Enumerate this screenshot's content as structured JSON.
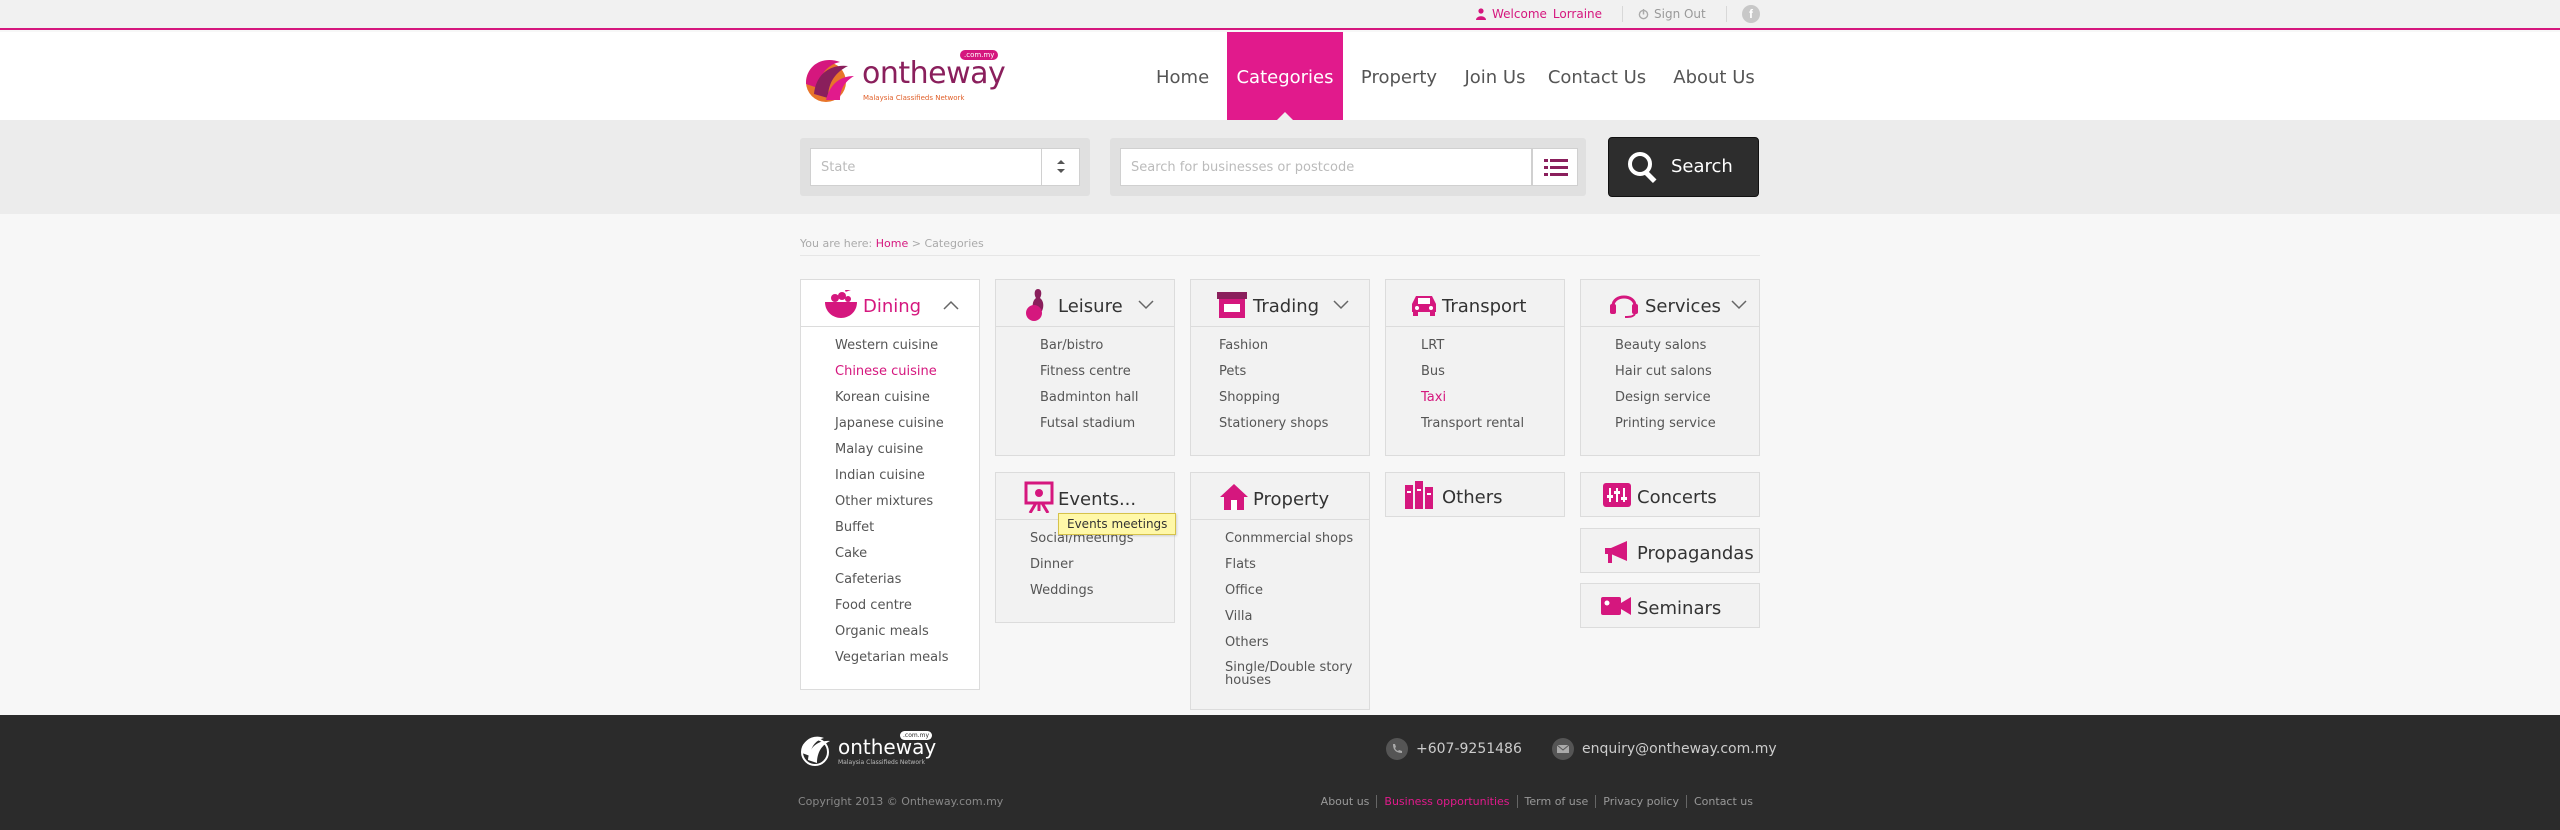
{
  "topbar": {
    "welcome_label": "Welcome",
    "user_name": "Lorraine",
    "signout_label": "Sign Out",
    "facebook_glyph": "f"
  },
  "header": {
    "logo_brand": "ontheway",
    "logo_tagline": "Malaysia Classifieds Network",
    "logo_domain": ".com.my",
    "nav": [
      {
        "label": "Home"
      },
      {
        "label": "Categories",
        "active": true
      },
      {
        "label": "Property"
      },
      {
        "label": "Join Us"
      },
      {
        "label": "Contact Us"
      },
      {
        "label": "About Us"
      }
    ]
  },
  "search": {
    "state_placeholder": "State",
    "query_placeholder": "Search for businesses or postcode",
    "button_label": "Search"
  },
  "breadcrumb": {
    "prefix": "You are here:",
    "home": "Home",
    "separator": ">",
    "current": "Categories"
  },
  "categories": {
    "dining": {
      "title": "Dining",
      "items": [
        "Western cuisine",
        "Chinese cuisine",
        "Korean cuisine",
        "Japanese cuisine",
        "Malay cuisine",
        "Indian cuisine",
        "Other mixtures",
        "Buffet",
        "Cake",
        "Cafeterias",
        "Food centre",
        "Organic meals",
        "Vegetarian meals"
      ]
    },
    "leisure": {
      "title": "Leisure",
      "items": [
        "Bar/bistro",
        "Fitness centre",
        "Badminton hall",
        "Futsal stadium"
      ]
    },
    "trading": {
      "title": "Trading",
      "items": [
        "Fashion",
        "Pets",
        "Shopping",
        "Stationery shops"
      ]
    },
    "transport": {
      "title": "Transport",
      "items": [
        "LRT",
        "Bus",
        "Taxi",
        "Transport  rental"
      ]
    },
    "services": {
      "title": "Services",
      "items": [
        "Beauty  salons",
        "Hair  cut  salons",
        "Design  service",
        "Printing  service"
      ]
    },
    "events": {
      "title": "Events...",
      "items": [
        "Social/meetings",
        "Dinner",
        "Weddings"
      ],
      "tooltip": "Events  meetings"
    },
    "property": {
      "title": "Property",
      "items": [
        "Conmmercial  shops",
        "Flats",
        "Office",
        "Villa",
        "Others",
        "Single/Double story houses"
      ]
    },
    "others": {
      "title": "Others"
    },
    "concerts": {
      "title": "Concerts"
    },
    "propagandas": {
      "title": "Propagandas"
    },
    "seminars": {
      "title": "Seminars"
    }
  },
  "footer": {
    "logo_brand": "ontheway",
    "logo_tagline": "Malaysia Classifieds Network",
    "logo_domain": ".com.my",
    "phone": "+607-9251486",
    "email": "enquiry@ontheway.com.my",
    "copyright": "Copyright 2013 © Ontheway.com.my",
    "links": [
      "About us",
      "Business opportunities",
      "Term of use",
      "Privacy policy",
      "Contact us"
    ]
  },
  "colors": {
    "accent": "#e11a8c",
    "footer_bg": "#2b2b2b",
    "search_button_bg": "#2d2d2d"
  }
}
